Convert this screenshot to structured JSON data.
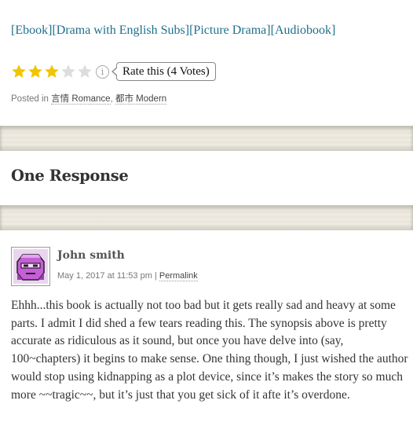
{
  "formats": {
    "items": [
      "[Ebook]",
      "[Drama with English Subs]",
      "[Picture Drama]",
      "[Audiobook]"
    ]
  },
  "rating": {
    "filled_stars": 3,
    "max_stars": 5,
    "filled_color": "#f2c500",
    "empty_color": "#dddddd",
    "info_icon": "info-icon",
    "rate_label": "Rate this (4 Votes)"
  },
  "post_meta": {
    "posted_in_label": "Posted in",
    "categories": [
      "言情 Romance",
      "都市 Modern"
    ],
    "separator": ","
  },
  "responses": {
    "title": "One Response"
  },
  "comment": {
    "author": "John smith",
    "date": "May 1, 2017 at 11:53 pm",
    "meta_separator": "|",
    "permalink_label": "Permalink",
    "body": "Ehhh...this book is actually not too bad but it gets really sad and heavy at some parts. I admit I did shed a few tears reading this. The synopsis above is pretty accurate as ridiculous as it sound, but once you have delve into (say, 100~chapters) it begins to make sense. One thing though, I just wished the author would stop using kidnapping as a plot device, since it’s makes the story so much more ~~tragic~~, but it’s just that you get sick of it afte it’s overdone."
  }
}
